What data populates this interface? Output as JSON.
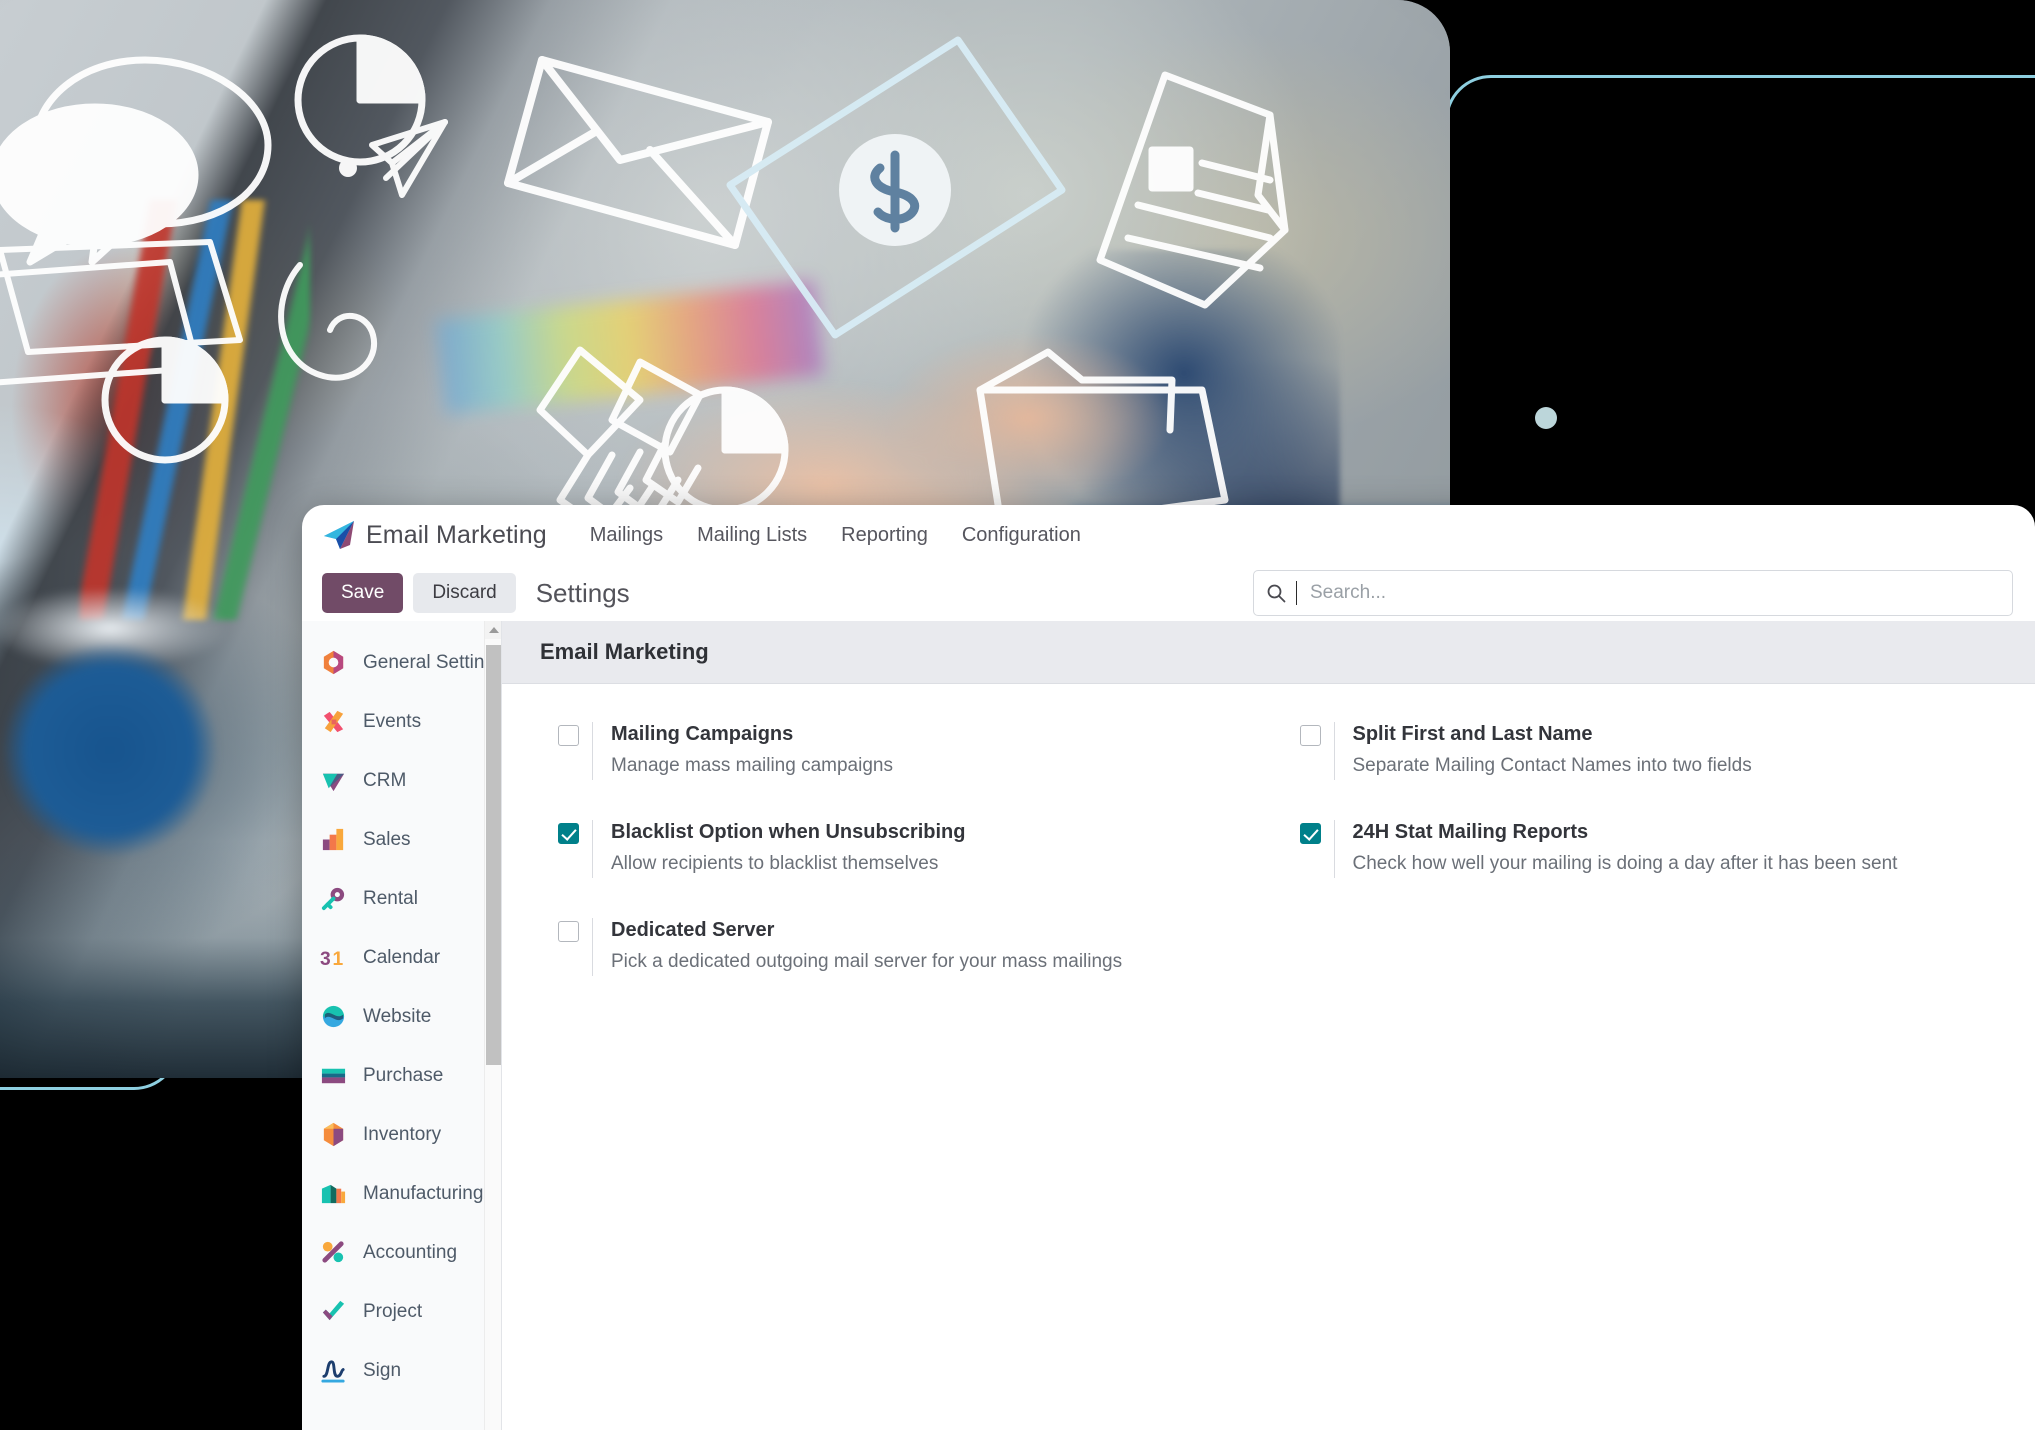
{
  "app": {
    "brand_name": "Email Marketing",
    "logo_icon": "paper-plane-icon",
    "nav": [
      {
        "label": "Mailings"
      },
      {
        "label": "Mailing Lists"
      },
      {
        "label": "Reporting"
      },
      {
        "label": "Configuration"
      }
    ]
  },
  "controlbar": {
    "save_label": "Save",
    "discard_label": "Discard",
    "page_title": "Settings"
  },
  "search": {
    "icon": "search-icon",
    "placeholder": "Search...",
    "value": ""
  },
  "sidebar": {
    "items": [
      {
        "label": "General Settings",
        "icon": "settings-gear-icon"
      },
      {
        "label": "Events",
        "icon": "events-icon"
      },
      {
        "label": "CRM",
        "icon": "crm-icon"
      },
      {
        "label": "Sales",
        "icon": "sales-bars-icon"
      },
      {
        "label": "Rental",
        "icon": "key-icon"
      },
      {
        "label": "Calendar",
        "icon": "calendar-31-icon"
      },
      {
        "label": "Website",
        "icon": "website-globe-icon"
      },
      {
        "label": "Purchase",
        "icon": "purchase-card-icon"
      },
      {
        "label": "Inventory",
        "icon": "inventory-box-icon"
      },
      {
        "label": "Manufacturing",
        "icon": "manufacturing-icon"
      },
      {
        "label": "Accounting",
        "icon": "accounting-icon"
      },
      {
        "label": "Project",
        "icon": "project-check-icon"
      },
      {
        "label": "Sign",
        "icon": "sign-pen-icon"
      }
    ]
  },
  "settings": {
    "section_title": "Email Marketing",
    "options": [
      {
        "title": "Mailing Campaigns",
        "description": "Manage mass mailing campaigns",
        "checked": false
      },
      {
        "title": "Split First and Last Name",
        "description": "Separate Mailing Contact Names into two fields",
        "checked": false
      },
      {
        "title": "Blacklist Option when Unsubscribing",
        "description": "Allow recipients to blacklist themselves",
        "checked": true
      },
      {
        "title": "24H Stat Mailing Reports",
        "description": "Check how well your mailing is doing a day after it has been sent",
        "checked": true
      },
      {
        "title": "Dedicated Server",
        "description": "Pick a dedicated outgoing mail server for your mass mailings",
        "checked": false
      }
    ]
  },
  "colors": {
    "brand_purple": "#714B67",
    "checkbox_teal": "#00808A",
    "section_header_bg": "#E9EAEE",
    "sidebar_bg": "#F9FAFB",
    "deco_line": "#8ECFE0",
    "deco_dot": "#BCD6DA"
  },
  "decor": {
    "photo_overlay_icons": [
      "speech-bubbles-icon",
      "pie-chart-icon",
      "envelope-icon",
      "paper-plane-icon",
      "dollar-banknote-icon",
      "document-icon",
      "handshake-icon",
      "folder-icon",
      "pie-chart-small-icon",
      "dot-icon",
      "swirl-arrow-icon",
      "rectangle-outline-icon"
    ]
  }
}
